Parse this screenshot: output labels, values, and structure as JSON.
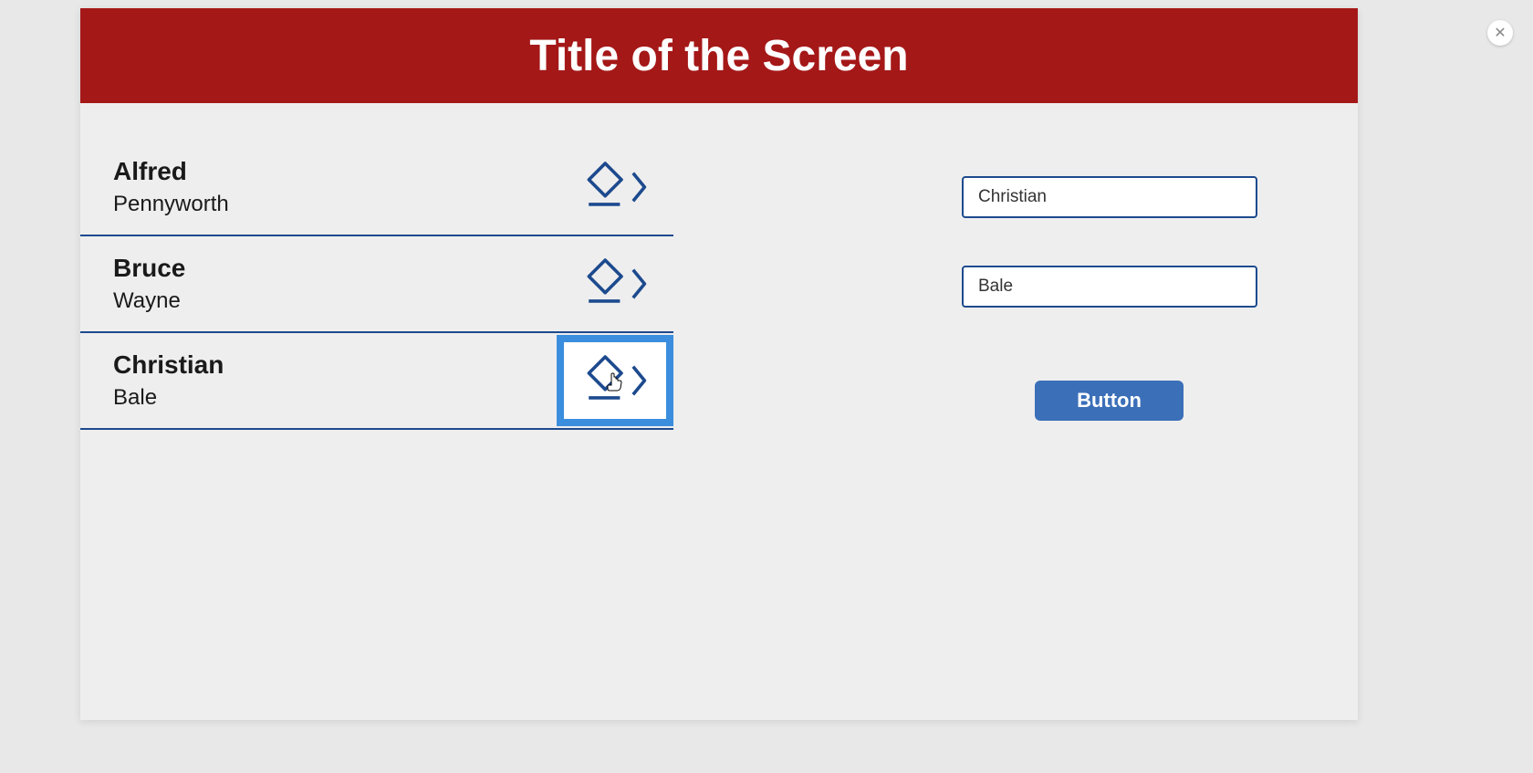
{
  "header": {
    "title": "Title of the Screen"
  },
  "list": {
    "items": [
      {
        "first": "Alfred",
        "second": "Pennyworth",
        "selected": false
      },
      {
        "first": "Bruce",
        "second": "Wayne",
        "selected": false
      },
      {
        "first": "Christian",
        "second": "Bale",
        "selected": true
      }
    ]
  },
  "form": {
    "input1_value": "Christian",
    "input2_value": "Bale",
    "button_label": "Button"
  }
}
